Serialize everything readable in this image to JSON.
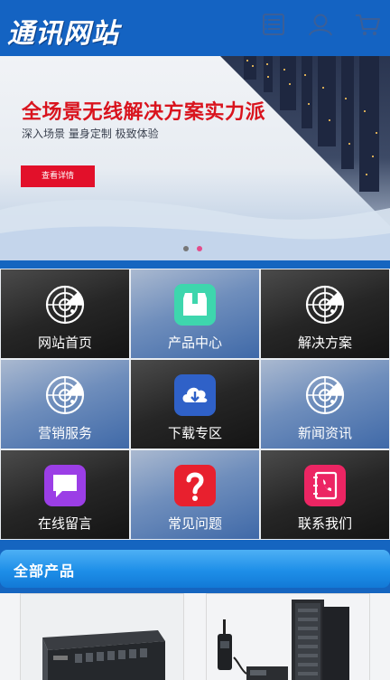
{
  "header": {
    "logo": "通讯网站",
    "icons": [
      "menu-icon",
      "user-icon",
      "cart-icon"
    ]
  },
  "banner": {
    "title": "全场景无线解决方案实力派",
    "subtitle": "深入场景 量身定制 极致体验",
    "button": "查看详情",
    "slide_count": 2,
    "active_slide": 2
  },
  "nav_grid": [
    {
      "label": "网站首页",
      "icon": "radar-icon"
    },
    {
      "label": "产品中心",
      "icon": "box-icon"
    },
    {
      "label": "解决方案",
      "icon": "radar-icon"
    },
    {
      "label": "营销服务",
      "icon": "radar-icon"
    },
    {
      "label": "下载专区",
      "icon": "cloud-download-icon"
    },
    {
      "label": "新闻资讯",
      "icon": "radar-icon"
    },
    {
      "label": "在线留言",
      "icon": "chat-icon"
    },
    {
      "label": "常见问题",
      "icon": "question-icon"
    },
    {
      "label": "联系我们",
      "icon": "contact-book-icon"
    }
  ],
  "section": {
    "title": "全部产品"
  },
  "colors": {
    "header": "#1463c2",
    "accent_red": "#e2102a",
    "section_bar": "#1e8fe8"
  }
}
